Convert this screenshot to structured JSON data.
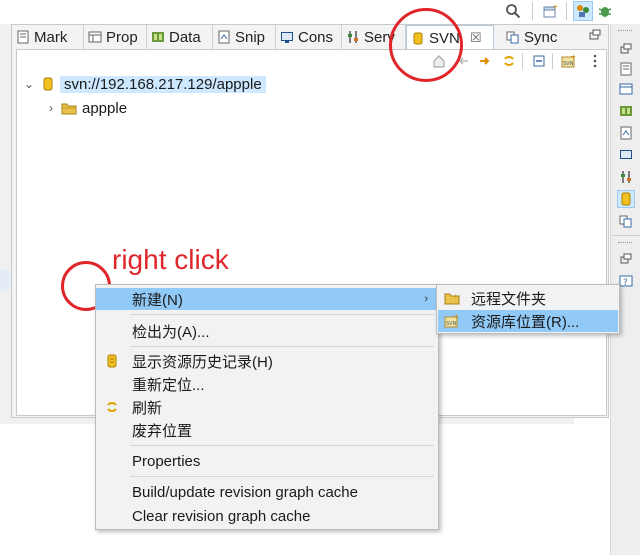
{
  "top_toolbar": {
    "icons": [
      "search-icon",
      "open-perspective-icon",
      "svn-perspective-icon",
      "debug-perspective-icon"
    ]
  },
  "tabs": [
    {
      "label": "Mark",
      "icon": "markers-icon"
    },
    {
      "label": "Prop",
      "icon": "properties-icon"
    },
    {
      "label": "Data",
      "icon": "data-source-icon"
    },
    {
      "label": "Snip",
      "icon": "snippets-icon"
    },
    {
      "label": "Cons",
      "icon": "console-icon"
    },
    {
      "label": "Serv",
      "icon": "servers-icon"
    },
    {
      "label": "SVN",
      "icon": "svn-repository-icon",
      "active": true,
      "close": "☒"
    },
    {
      "label": "Sync",
      "icon": "synchronize-icon"
    }
  ],
  "tree": {
    "root_label": "svn://192.168.217.129/appple",
    "root_expand": "⌄",
    "child_label": "appple",
    "child_expand": "›"
  },
  "annotation": {
    "note": "right click",
    "note_color": "#e0262a"
  },
  "context_menu": {
    "items": [
      {
        "label": "新建(N)",
        "has_submenu": true,
        "highlighted": true
      },
      {
        "label": "检出为(A)..."
      },
      {
        "label": "显示资源历史记录(H)",
        "icon": "history-icon"
      },
      {
        "label": "重新定位..."
      },
      {
        "label": "刷新",
        "icon": "refresh-icon"
      },
      {
        "label": "废弃位置"
      },
      {
        "label": "Properties"
      },
      {
        "label": "Build/update revision graph cache"
      },
      {
        "label": "Clear revision graph cache"
      }
    ],
    "submenu_arrow": "›"
  },
  "submenu": {
    "items": [
      {
        "label": "远程文件夹",
        "icon": "folder-icon"
      },
      {
        "label": "资源库位置(R)...",
        "icon": "repository-location-icon",
        "highlighted": true
      }
    ]
  },
  "colors": {
    "highlight": "#91c9f7",
    "selection": "#cde8ff",
    "menu_bg": "#f2f2f2"
  }
}
